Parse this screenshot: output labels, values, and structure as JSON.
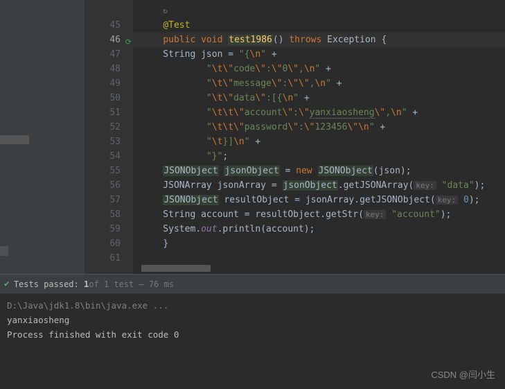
{
  "gutter": {
    "lines": [
      "",
      "45",
      "46",
      "47",
      "48",
      "49",
      "50",
      "51",
      "52",
      "53",
      "54",
      "55",
      "56",
      "57",
      "58",
      "59",
      "60",
      "61"
    ],
    "highlighted": "46",
    "icon_line": "46"
  },
  "code": {
    "l0_icon": "↻",
    "l1_anno": "@Test",
    "l2": {
      "kw1": "public",
      "kw2": "void",
      "method": "test1986",
      "parens": "()",
      "kw3": "throws",
      "exc": "Exception",
      "brace": "{"
    },
    "l3": {
      "pre": "    String json = ",
      "s1": "\"{",
      "e1": "\\n",
      "s2": "\"",
      "plus": " +"
    },
    "l4": {
      "pre": "            ",
      "s1": "\"",
      "e1": "\\t\\\"",
      "s2": "code",
      "e2": "\\\"",
      "s3": ":",
      "e3": "\\\"",
      "s4": "0",
      "e4": "\\\"",
      "s5": ",",
      "e5": "\\n",
      "s6": "\"",
      "plus": " +"
    },
    "l5": {
      "pre": "            ",
      "s1": "\"",
      "e1": "\\t\\\"",
      "s2": "message",
      "e2": "\\\"",
      "s3": ":",
      "e3": "\\\"\\\"",
      "s4": ",",
      "e4": "\\n",
      "s5": "\"",
      "plus": " +"
    },
    "l6": {
      "pre": "            ",
      "s1": "\"",
      "e1": "\\t\\\"",
      "s2": "data",
      "e2": "\\\"",
      "s3": ":[{",
      "e3": "\\n",
      "s4": "\"",
      "plus": " +"
    },
    "l7": {
      "pre": "            ",
      "s1": "\"",
      "e1": "\\t\\t\\\"",
      "s2": "account",
      "e2": "\\\"",
      "s3": ":",
      "e3": "\\\"",
      "s4": "yanxiaosheng",
      "e4": "\\\"",
      "s5": ",",
      "e5": "\\n",
      "s6": "\"",
      "plus": " +"
    },
    "l8": {
      "pre": "            ",
      "s1": "\"",
      "e1": "\\t\\t\\\"",
      "s2": "password",
      "e2": "\\\"",
      "s3": ":",
      "e3": "\\\"",
      "s4": "123456",
      "e4": "\\\"\\n",
      "s5": "\"",
      "plus": " +"
    },
    "l9": {
      "pre": "            ",
      "s1": "\"",
      "e1": "\\t",
      "s2": "}]",
      "e2": "\\n",
      "s3": "\"",
      "plus": " +"
    },
    "l10": {
      "pre": "            ",
      "s1": "\"}\"",
      "semi": ";"
    },
    "l11": {
      "pre": "    ",
      "cls1": "JSONObject",
      "sp1": " ",
      "var1": "jsonObject",
      "sp2": " = ",
      "kw": "new",
      "sp3": " ",
      "cls2": "JSONObject",
      "rest": "(json);"
    },
    "l12": {
      "pre": "    JSONArray jsonArray = ",
      "var": "jsonObject",
      "m": ".getJSONArray(",
      "hint": "key:",
      "arg": " \"data\"",
      "end": ");"
    },
    "l13": {
      "pre": "    ",
      "cls": "JSONObject",
      "mid": " resultObject = jsonArray.getJSONObject(",
      "hint": "key:",
      "arg": " 0",
      "end": ");"
    },
    "l14": {
      "pre": "    String account = resultObject.getStr(",
      "hint": "key:",
      "arg": " \"account\"",
      "end": ");"
    },
    "l15": {
      "pre": "    System.",
      "out": "out",
      "rest": ".println(account);"
    },
    "l16": "}",
    "l17": ""
  },
  "tests": {
    "label": "Tests passed:",
    "count": "1",
    "detail": " of 1 test – 76 ms"
  },
  "console": {
    "line1": "D:\\Java\\jdk1.8\\bin\\java.exe ...",
    "line2": "yanxiaosheng",
    "line3": "",
    "line4": "Process finished with exit code 0"
  },
  "watermark": "CSDN @闫小生"
}
